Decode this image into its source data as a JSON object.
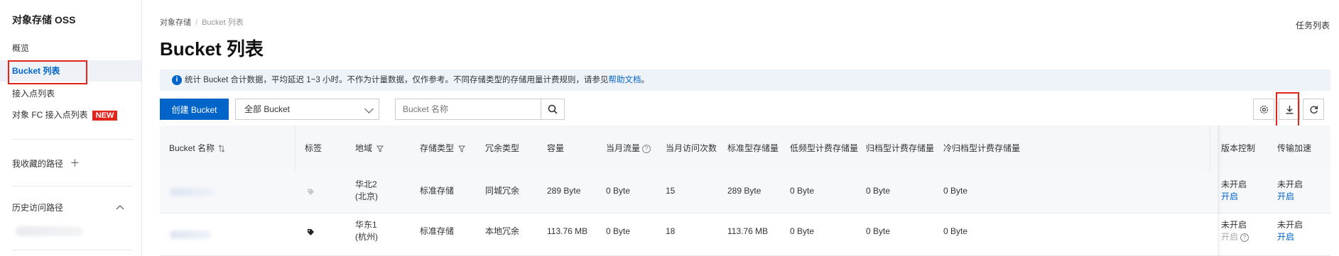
{
  "sidebar": {
    "title": "对象存储 OSS",
    "items": [
      {
        "label": "概览"
      },
      {
        "label": "Bucket 列表"
      },
      {
        "label": "接入点列表"
      },
      {
        "label": "对象 FC 接入点列表",
        "badge": "NEW"
      }
    ],
    "favorites_label": "我收藏的路径",
    "favorites_add": "＋",
    "history_label": "历史访问路径"
  },
  "header": {
    "breadcrumb": [
      "对象存储",
      "Bucket 列表"
    ],
    "title": "Bucket 列表",
    "tasks_link": "任务列表"
  },
  "notice": {
    "text": "统计 Bucket 合计数据，平均延迟 1~3 小时。不作为计量数据，仅作参考。不同存储类型的存储用量计费规则，请参见",
    "link": "帮助文档",
    "suffix": "。"
  },
  "toolbar": {
    "create_label": "创建 Bucket",
    "filter_selected": "全部 Bucket",
    "search_placeholder": "Bucket 名称"
  },
  "table": {
    "headers": {
      "name": "Bucket 名称",
      "tags": "标签",
      "region": "地域",
      "storage_class": "存储类型",
      "redundancy": "冗余类型",
      "capacity": "容量",
      "monthly_traffic": "当月流量",
      "monthly_requests": "当月访问次数",
      "standard": "标准型存储量",
      "ia": "低频型计费存储量",
      "archive": "归档型计费存储量",
      "cold_archive": "冷归档型计费存储量",
      "versioning": "版本控制",
      "acceleration": "传输加速"
    },
    "rows": [
      {
        "region_line1": "华北2",
        "region_line2": "(北京)",
        "storage_class": "标准存储",
        "redundancy": "同城冗余",
        "capacity": "289 Byte",
        "monthly_traffic": "0 Byte",
        "monthly_requests": "15",
        "standard": "289 Byte",
        "ia": "0 Byte",
        "archive": "0 Byte",
        "cold_archive": "0 Byte",
        "versioning_status": "未开启",
        "versioning_action": "开启",
        "accel_status": "未开启",
        "accel_action": "开启"
      },
      {
        "region_line1": "华东1",
        "region_line2": "(杭州)",
        "storage_class": "标准存储",
        "redundancy": "本地冗余",
        "capacity": "113.76 MB",
        "monthly_traffic": "0 Byte",
        "monthly_requests": "18",
        "standard": "113.76 MB",
        "ia": "0 Byte",
        "archive": "0 Byte",
        "cold_archive": "0 Byte",
        "versioning_status": "未开启",
        "versioning_action": "开启",
        "accel_status": "未开启",
        "accel_action": "开启"
      }
    ]
  },
  "colors": {
    "primary": "#0064c8",
    "highlight": "#e1251b",
    "notice_bg": "#eef3fa"
  }
}
